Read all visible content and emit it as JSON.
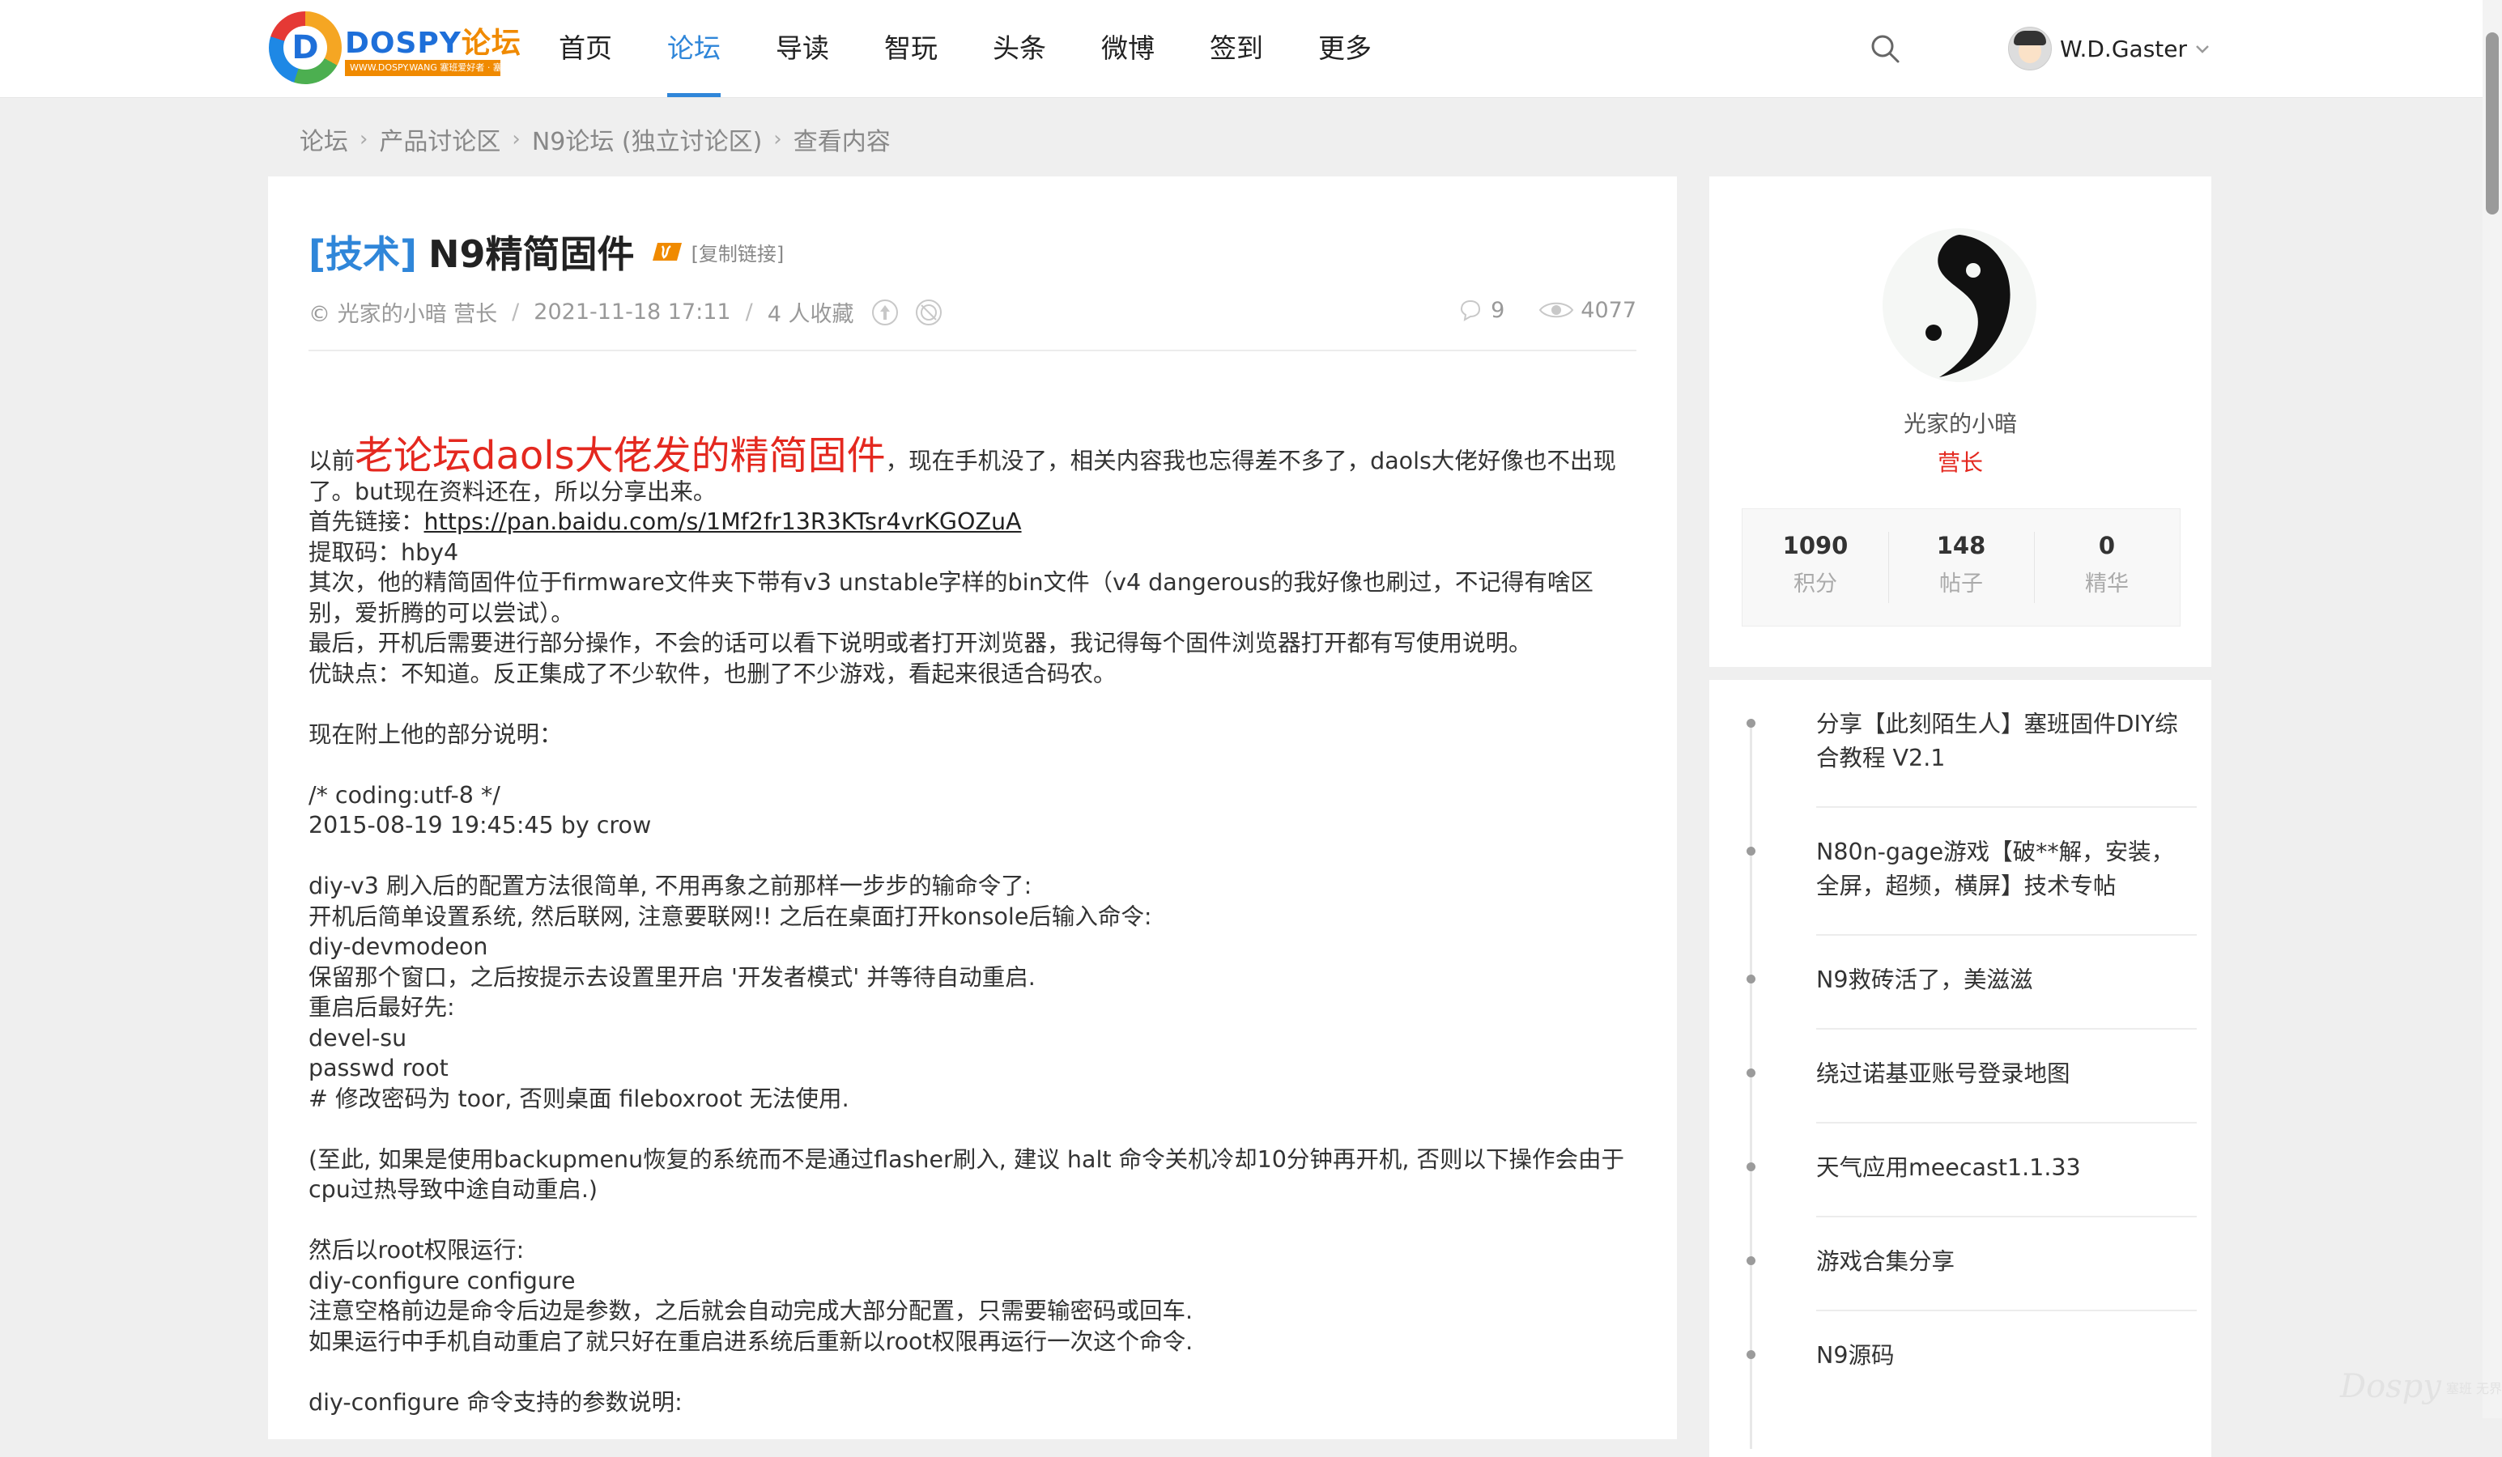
{
  "logo": {
    "brand": "DOSPY",
    "brand_cn": "论坛",
    "tagline": "WWW.DOSPY.WANG 塞班爱好者 · 塞班无界限"
  },
  "nav": {
    "items": [
      "首页",
      "论坛",
      "导读",
      "智玩",
      "头条",
      "微博",
      "签到",
      "更多"
    ],
    "active": "论坛"
  },
  "user": {
    "name": "W.D.Gaster"
  },
  "breadcrumb": [
    "论坛",
    "产品讨论区",
    "N9论坛 (独立讨论区)",
    "查看内容"
  ],
  "post": {
    "tag": "[技术]",
    "title": "N9精简固件",
    "copy_link": "[复制链接]",
    "author": "© 光家的小暗 营长",
    "date": "2021-11-18 17:11",
    "favorites": "4 人收藏",
    "comments": "9",
    "views": "4077",
    "intro_prefix": "以前",
    "intro_highlight": "老论坛daols大佬发的精简固件",
    "intro_rest": "，现在手机没了，相关内容我也忘得差不多了，daols大佬好像也不出现了。but现在资料还在，所以分享出来。",
    "link_label": "首先链接：",
    "link_url": "https://pan.baidu.com/s/1Mf2fr13R3KTsr4vrKGOZuA",
    "lines_a": [
      "提取码：hby4",
      "其次，他的精简固件位于firmware文件夹下带有v3 unstable字样的bin文件（v4 dangerous的我好像也刷过，不记得有啥区别，爱折腾的可以尝试）。",
      "最后，开机后需要进行部分操作，不会的话可以看下说明或者打开浏览器，我记得每个固件浏览器打开都有写使用说明。",
      "优缺点：不知道。反正集成了不少软件，也删了不少游戏，看起来很适合码农。"
    ],
    "line_b": "现在附上他的部分说明：",
    "lines_c": [
      "/* coding:utf-8 */",
      "2015-08-19 19:45:45 by crow"
    ],
    "lines_d": [
      "diy-v3 刷入后的配置方法很简单, 不用再象之前那样一步步的输命令了:",
      "开机后简单设置系统, 然后联网, 注意要联网!! 之后在桌面打开konsole后输入命令:",
      "diy-devmodeon",
      "保留那个窗口，之后按提示去设置里开启 '开发者模式' 并等待自动重启.",
      "重启后最好先:",
      "devel-su",
      "passwd root",
      "# 修改密码为 toor, 否则桌面 fileboxroot 无法使用."
    ],
    "line_e": "(至此, 如果是使用backupmenu恢复的系统而不是通过flasher刷入, 建议 halt 命令关机冷却10分钟再开机, 否则以下操作会由于cpu过热导致中途自动重启.)",
    "lines_f": [
      "然后以root权限运行:",
      "diy-configure  configure",
      "注意空格前边是命令后边是参数，之后就会自动完成大部分配置，只需要输密码或回车.",
      "如果运行中手机自动重启了就只好在重启进系统后重新以root权限再运行一次这个命令."
    ],
    "line_g": "diy-configure 命令支持的参数说明:"
  },
  "profile": {
    "name": "光家的小暗",
    "role": "营长",
    "stats": [
      {
        "value": "1090",
        "label": "积分"
      },
      {
        "value": "148",
        "label": "帖子"
      },
      {
        "value": "0",
        "label": "精华"
      }
    ]
  },
  "related": [
    "分享【此刻陌生人】塞班固件DIY综合教程 V2.1",
    "N80n-gage游戏【破**解，安装，全屏，超频，横屏】技术专帖",
    "N9救砖活了，美滋滋",
    "绕过诺基亚账号登录地图",
    "天气应用meecast1.1.33",
    "游戏合集分享",
    "N9源码"
  ],
  "watermark": {
    "brand": "Dospy",
    "tagline": "塞班\n无界"
  },
  "colors": {
    "accent": "#2f86d9",
    "highlight": "#e4281f",
    "page_bg": "#efefef"
  },
  "icons": [
    "search-icon",
    "chevron-down-icon",
    "hot-icon",
    "up-icon",
    "share-icon",
    "comment-icon",
    "eye-icon"
  ]
}
